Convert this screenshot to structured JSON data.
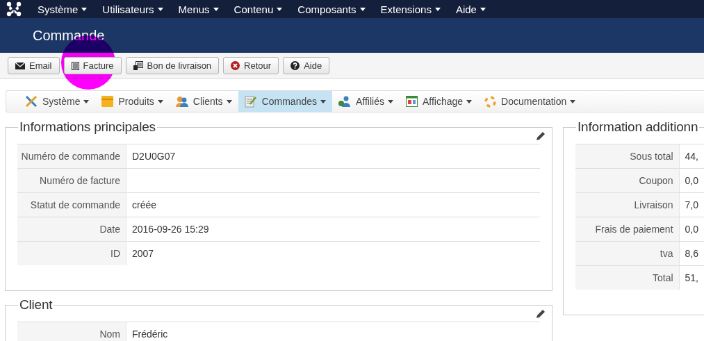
{
  "top_menu": [
    {
      "label": "Système"
    },
    {
      "label": "Utilisateurs"
    },
    {
      "label": "Menus"
    },
    {
      "label": "Contenu"
    },
    {
      "label": "Composants"
    },
    {
      "label": "Extensions"
    },
    {
      "label": "Aide"
    }
  ],
  "page_title": "Commande",
  "toolbar": [
    {
      "label": "Email",
      "kind": "email",
      "highlighted": false
    },
    {
      "label": "Facture",
      "kind": "invoice",
      "highlighted": true
    },
    {
      "label": "Bon de livraison",
      "kind": "delivery",
      "highlighted": false
    },
    {
      "label": "Retour",
      "kind": "back",
      "highlighted": false
    },
    {
      "label": "Aide",
      "kind": "help",
      "highlighted": false
    }
  ],
  "submenu": [
    {
      "label": "Système",
      "kind": "tools",
      "selected": false
    },
    {
      "label": "Produits",
      "kind": "box",
      "selected": false
    },
    {
      "label": "Clients",
      "kind": "users",
      "selected": false
    },
    {
      "label": "Commandes",
      "kind": "orders",
      "selected": true
    },
    {
      "label": "Affiliés",
      "kind": "affiliates",
      "selected": false
    },
    {
      "label": "Affichage",
      "kind": "display",
      "selected": false
    },
    {
      "label": "Documentation",
      "kind": "docs",
      "selected": false
    }
  ],
  "main_info": {
    "title": "Informations principales",
    "rows": [
      {
        "label": "Numéro de commande",
        "value": "D2U0G07"
      },
      {
        "label": "Numéro de facture",
        "value": ""
      },
      {
        "label": "Statut de commande",
        "value": "créée"
      },
      {
        "label": "Date",
        "value": "2016-09-26 15:29"
      },
      {
        "label": "ID",
        "value": "2007"
      }
    ]
  },
  "client": {
    "title": "Client",
    "rows": [
      {
        "label": "Nom",
        "value": "Frédéric"
      }
    ]
  },
  "additional_info": {
    "title": "Information additionn",
    "rows": [
      {
        "label": "Sous total",
        "value": "44,"
      },
      {
        "label": "Coupon",
        "value": "0,0"
      },
      {
        "label": "Livraison",
        "value": "7,0"
      },
      {
        "label": "Frais de paiement",
        "value": "0,0"
      },
      {
        "label": "tva",
        "value": "8,6"
      },
      {
        "label": "Total",
        "value": "51,"
      }
    ]
  }
}
